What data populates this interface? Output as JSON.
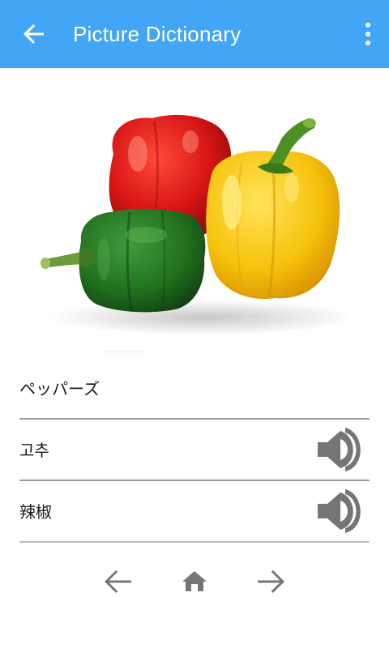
{
  "appbar": {
    "title": "Picture Dictionary",
    "back_icon": "arrow-left-icon",
    "menu_icon": "more-vert-icon",
    "color": "#42a5f5"
  },
  "entry": {
    "image": "bell-peppers-red-yellow-green",
    "words": [
      {
        "text": "ペッパーズ"
      },
      {
        "text": "고추",
        "audio_icon": "speaker-icon"
      },
      {
        "text": "辣椒",
        "audio_icon": "speaker-icon"
      }
    ]
  },
  "nav": {
    "prev_icon": "arrow-left-icon",
    "home_icon": "home-icon",
    "next_icon": "arrow-right-icon"
  }
}
